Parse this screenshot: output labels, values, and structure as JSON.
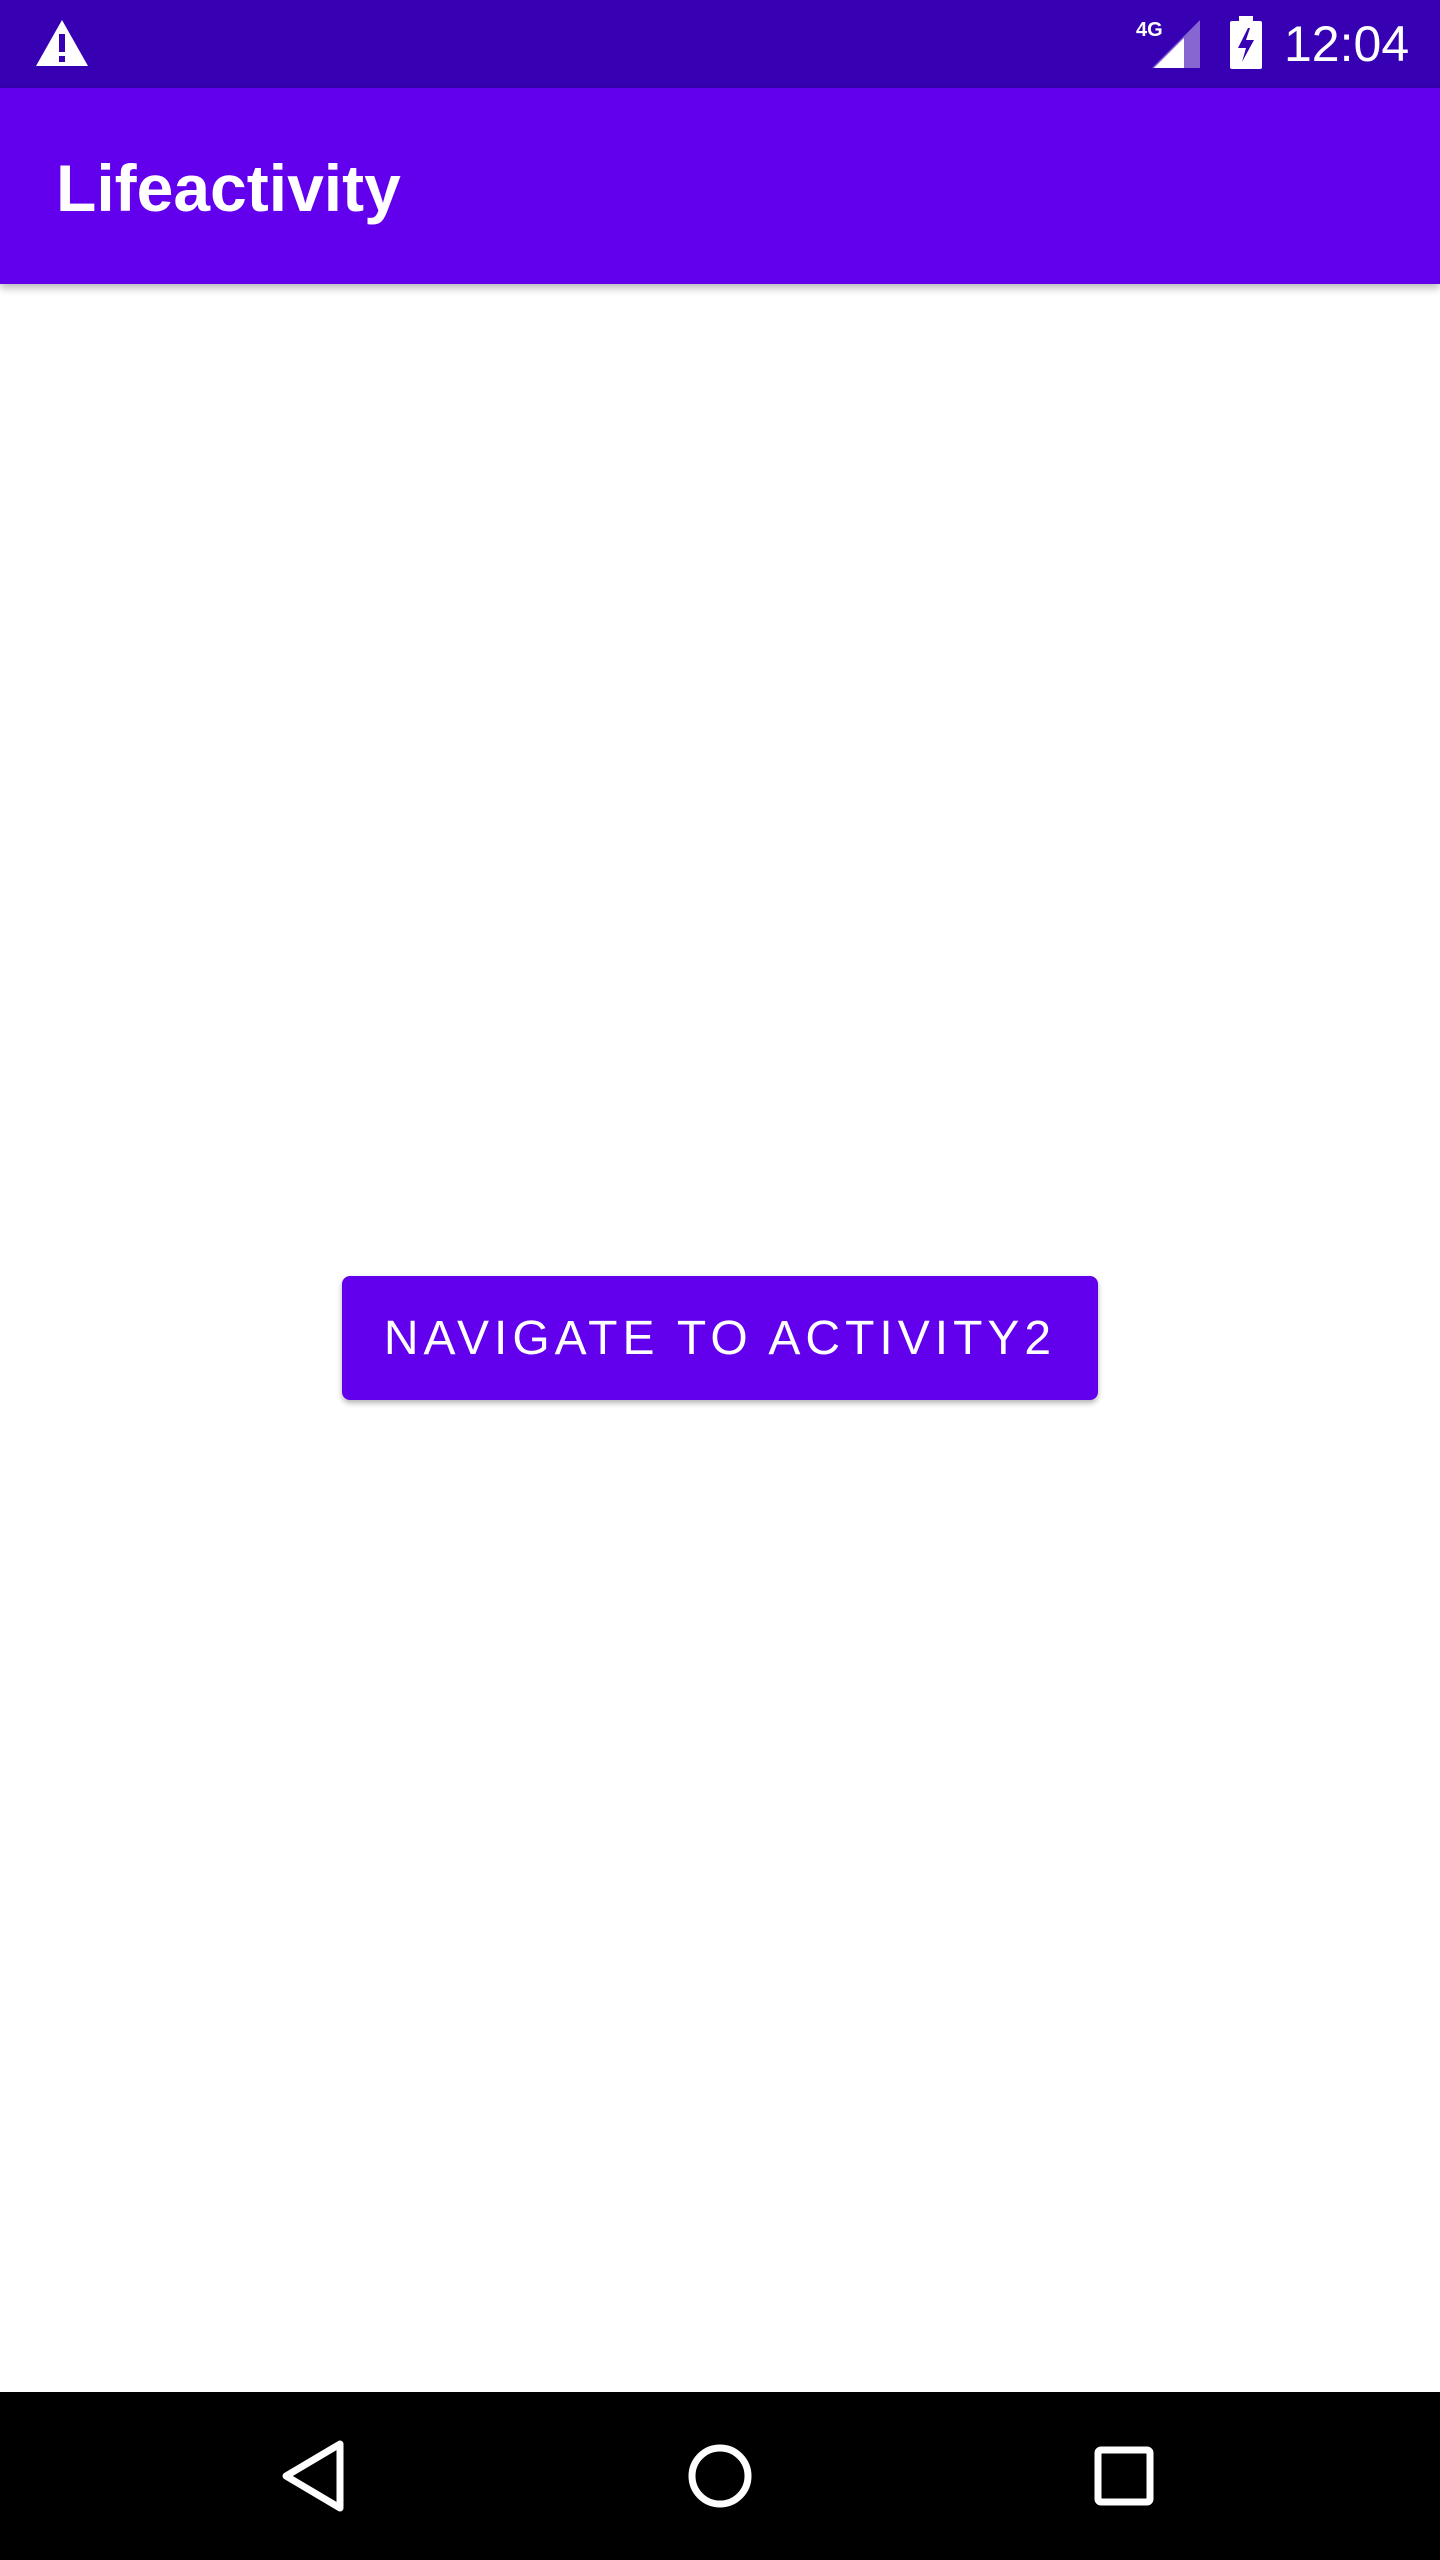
{
  "status_bar": {
    "time": "12:04",
    "network_label": "4G",
    "background": "#3700b3"
  },
  "app_bar": {
    "title": "Lifeactivity",
    "background": "#6200ee"
  },
  "main": {
    "navigate_button_label": "NAVIGATE TO ACTIVITY2",
    "button_color": "#6200ee"
  },
  "navigation_bar": {
    "background": "#000000",
    "buttons": [
      "back-icon",
      "home-icon",
      "recents-icon"
    ]
  }
}
